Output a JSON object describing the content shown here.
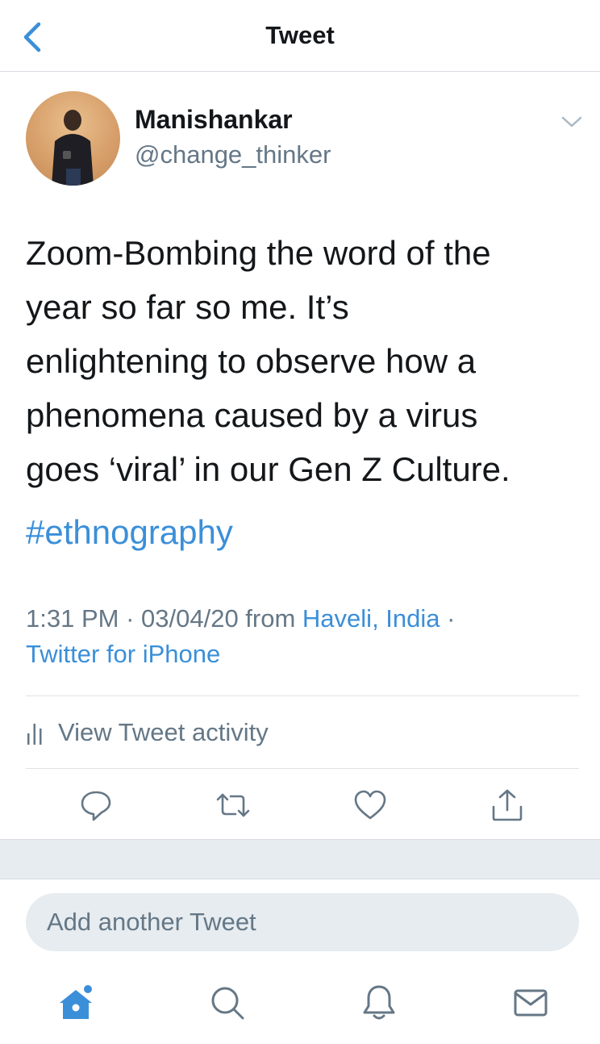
{
  "header": {
    "title": "Tweet",
    "back_icon": "chevron-left-icon"
  },
  "author": {
    "name": "Manishankar",
    "handle": "@change_thinker"
  },
  "tweet": {
    "text": "Zoom-Bombing the word of the\nyear so far so me. It’s\nenlightening to observe how a\nphenomena caused by a virus\ngoes ‘viral’ in our Gen Z Culture.",
    "hashtag": "#ethnography"
  },
  "meta": {
    "time": "1:31 PM",
    "sep1": " · ",
    "date": "03/04/20",
    "from": " from ",
    "location": "Haveli, India",
    "sep2": " ·",
    "source": "Twitter for iPhone"
  },
  "activity": {
    "label": "View Tweet activity",
    "icon": "bar-chart-icon"
  },
  "actions": [
    {
      "name": "reply",
      "icon": "reply-icon"
    },
    {
      "name": "retweet",
      "icon": "retweet-icon"
    },
    {
      "name": "like",
      "icon": "heart-icon"
    },
    {
      "name": "share",
      "icon": "share-icon"
    }
  ],
  "compose": {
    "placeholder": "Add another Tweet"
  },
  "tabs": [
    {
      "name": "home",
      "icon": "home-icon",
      "active": true
    },
    {
      "name": "search",
      "icon": "search-icon"
    },
    {
      "name": "notifications",
      "icon": "bell-icon"
    },
    {
      "name": "messages",
      "icon": "mail-icon"
    }
  ],
  "colors": {
    "accent": "#3b8fd9",
    "text": "#14171a",
    "secondary": "#657786",
    "band": "#e6ecf0"
  }
}
